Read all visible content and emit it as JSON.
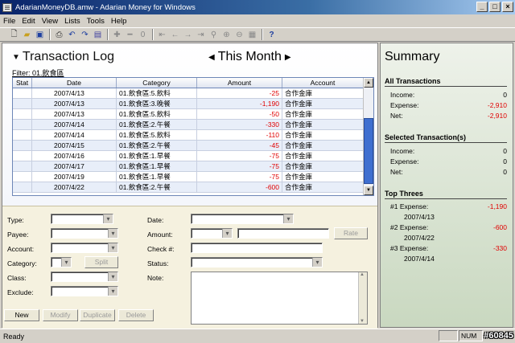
{
  "window": {
    "title": "AdarianMoneyDB.amw - Adarian Money for Windows",
    "min": "_",
    "max": "□",
    "close": "×"
  },
  "menu": [
    "File",
    "Edit",
    "View",
    "Lists",
    "Tools",
    "Help"
  ],
  "toolbar_icons": [
    "new-icon",
    "open-icon",
    "save-icon",
    "print-icon",
    "undo-icon",
    "redo-icon",
    "report-icon",
    "add-icon",
    "remove-icon",
    "zero-icon",
    "first-icon",
    "prev-icon",
    "next-icon",
    "last-icon",
    "search-icon",
    "zoom-in-icon",
    "zoom-out-icon",
    "settings-icon",
    "help-icon"
  ],
  "transaction_log": {
    "title": "Transaction Log",
    "period": "This Month",
    "filter": "Filter: 01.飲食區",
    "columns": [
      "Stat",
      "Date",
      "Category",
      "Amount",
      "Account"
    ],
    "rows": [
      {
        "date": "2007/4/13",
        "category": "01.飲食區:5.飲料",
        "amount": "-25",
        "account": "合作金庫"
      },
      {
        "date": "2007/4/13",
        "category": "01.飲食區:3.晚餐",
        "amount": "-1,190",
        "account": "合作金庫"
      },
      {
        "date": "2007/4/13",
        "category": "01.飲食區:5.飲料",
        "amount": "-50",
        "account": "合作金庫"
      },
      {
        "date": "2007/4/14",
        "category": "01.飲食區:2.午餐",
        "amount": "-330",
        "account": "合作金庫"
      },
      {
        "date": "2007/4/14",
        "category": "01.飲食區:5.飲料",
        "amount": "-110",
        "account": "合作金庫"
      },
      {
        "date": "2007/4/15",
        "category": "01.飲食區:2.午餐",
        "amount": "-45",
        "account": "合作金庫"
      },
      {
        "date": "2007/4/16",
        "category": "01.飲食區:1.早餐",
        "amount": "-75",
        "account": "合作金庫"
      },
      {
        "date": "2007/4/17",
        "category": "01.飲食區:1.早餐",
        "amount": "-75",
        "account": "合作金庫"
      },
      {
        "date": "2007/4/19",
        "category": "01.飲食區:1.早餐",
        "amount": "-75",
        "account": "合作金庫"
      },
      {
        "date": "2007/4/22",
        "category": "01.飲食區:2.午餐",
        "amount": "-600",
        "account": "合作金庫"
      }
    ]
  },
  "form": {
    "type": "Type:",
    "payee": "Payee:",
    "account": "Account:",
    "category": "Category:",
    "class": "Class:",
    "exclude": "Exclude:",
    "date": "Date:",
    "amount": "Amount:",
    "check": "Check #:",
    "status": "Status:",
    "note": "Note:",
    "split": "Split",
    "rate": "Rate",
    "new": "New",
    "modify": "Modify",
    "duplicate": "Duplicate",
    "delete": "Delete"
  },
  "summary": {
    "title": "Summary",
    "all": {
      "heading": "All Transactions",
      "income_label": "Income:",
      "income": "0",
      "expense_label": "Expense:",
      "expense": "-2,910",
      "net_label": "Net:",
      "net": "-2,910"
    },
    "selected": {
      "heading": "Selected Transaction(s)",
      "income_label": "Income:",
      "income": "0",
      "expense_label": "Expense:",
      "expense": "0",
      "net_label": "Net:",
      "net": "0"
    },
    "top": {
      "heading": "Top Threes",
      "items": [
        {
          "label": "#1 Expense:",
          "value": "-1,190",
          "date": "2007/4/13"
        },
        {
          "label": "#2 Expense:",
          "value": "-600",
          "date": "2007/4/22"
        },
        {
          "label": "#3 Expense:",
          "value": "-330",
          "date": "2007/4/14"
        }
      ]
    }
  },
  "status": {
    "text": "Ready",
    "num": "NUM",
    "watermark": "#60845"
  }
}
